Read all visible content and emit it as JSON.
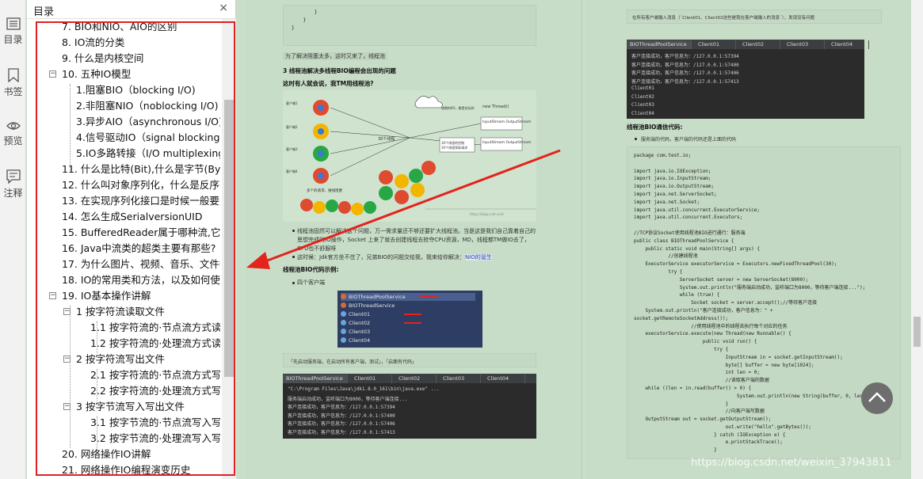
{
  "rail": {
    "items": [
      {
        "label": "目录",
        "icon": "list-icon"
      },
      {
        "label": "书签",
        "icon": "bookmark-icon"
      },
      {
        "label": "预览",
        "icon": "eye-icon"
      },
      {
        "label": "注释",
        "icon": "comment-icon"
      }
    ]
  },
  "outline": {
    "title": "目录",
    "close": "×",
    "items": [
      {
        "text": "7. BIO和NIO、AIO的区别",
        "toggle": ""
      },
      {
        "text": "8. IO流的分类",
        "toggle": ""
      },
      {
        "text": "9. 什么是内核空间",
        "toggle": ""
      },
      {
        "text": "10. 五种IO模型",
        "toggle": "−"
      },
      {
        "text": "1.阻塞BIO（blocking I/O)",
        "toggle": ""
      },
      {
        "text": "2.非阻塞NIO（noblocking I/O)",
        "toggle": ""
      },
      {
        "text": "3.异步AIO（asynchronous I/O)",
        "toggle": ""
      },
      {
        "text": "4.信号驱动IO（signal blocking I/",
        "toggle": ""
      },
      {
        "text": "5.IO多路转接（I/O multiplexing)",
        "toggle": ""
      },
      {
        "text": "11. 什么是比特(Bit),什么是字节(Byte)",
        "toggle": ""
      },
      {
        "text": "12. 什么叫对象序列化，什么是反序列",
        "toggle": ""
      },
      {
        "text": "13. 在实现序列化接口是时候一般要生",
        "toggle": ""
      },
      {
        "text": "14. 怎么生成SerialversionUID",
        "toggle": ""
      },
      {
        "text": "15. BufferedReader属于哪种流,它主",
        "toggle": ""
      },
      {
        "text": "16. Java中流类的超类主要有那些?",
        "toggle": ""
      },
      {
        "text": "17. 为什么图片、视频、音乐、文件等",
        "toggle": ""
      },
      {
        "text": "18. IO的常用类和方法，以及如何使用",
        "toggle": ""
      },
      {
        "text": "19. IO基本操作讲解",
        "toggle": "−"
      },
      {
        "text": "1 按字符流读取文件",
        "toggle": "−"
      },
      {
        "text": "1.1 按字符流的·节点流方式读取",
        "toggle": ""
      },
      {
        "text": "1.2 按字符流的·处理流方式读取",
        "toggle": ""
      },
      {
        "text": "2 按字符流写出文件",
        "toggle": "−"
      },
      {
        "text": "2.1 按字符流的·节点流方式写出",
        "toggle": ""
      },
      {
        "text": "2.2 按字符流的·处理流方式写出",
        "toggle": ""
      },
      {
        "text": "3 按字节流写入写出文件",
        "toggle": "−"
      },
      {
        "text": "3.1 按字节流的·节点流写入写出",
        "toggle": ""
      },
      {
        "text": "3.2 按字节流的·处理流写入写出",
        "toggle": ""
      },
      {
        "text": "20. 网络操作IO讲解",
        "toggle": ""
      },
      {
        "text": "21. 网络操作IO编程演变历史",
        "toggle": ""
      }
    ]
  },
  "doc": {
    "left": {
      "code_top": "        }\n    }\n}",
      "note1": "为了解决阻塞太多，这时又来了，线程池",
      "h3": "3 线程池解决多线程BIO编程会出现的问题",
      "q": "这时有人就会说，我TM用线程池?",
      "diagram": {
        "client_label": "多个客户端",
        "pool_label": "30个线程",
        "server": "new Thread()",
        "stream": "InputStream OutputStream",
        "multi": "多个的请求，维线阻塞",
        "desc1": "该期的IIO，都是实际的",
        "desc2": "30个线程的控制",
        "desc3": "30个线程获取请求",
        "rows": [
          "客户端1",
          "客户端2",
          "客户端3",
          "客户端4"
        ],
        "url": "https://blog.csdn.net/"
      },
      "bullet1": "线程池固然可以解决这个问题，万一需求量还不够还要扩大线程池。当是这是我们自己靠着自己的",
      "bullet1b": "思想完成的IO操作，Socket 上来了就去创建线程去抢夺CPU资源，MD，线程都TM做IO去了，",
      "bullet1c": "CPU也不舒服呀",
      "bullet2_a": "这时候：Jdk官方坐不住了，兄弟BIO的问题交给我，我来给你解决：",
      "bullet2_b": "NIO的诞生",
      "h4": "线程池BIO代码示例:",
      "bullet3": "四个客户端",
      "ide_items": [
        {
          "name": "BIOThreadPoolService",
          "color": "#d46a3a"
        },
        {
          "name": "BIOThreadService",
          "color": "#d46a3a"
        },
        {
          "name": "Client01",
          "color": "#6aa6d8"
        },
        {
          "name": "Client02",
          "color": "#6aa6d8"
        },
        {
          "name": "Client03",
          "color": "#6aa6d8"
        },
        {
          "name": "Client04",
          "color": "#6aa6d8"
        }
      ],
      "note2": "「先启动服务端，在启动所有客户端，测试」，「启面有代码」",
      "term": {
        "tabs": [
          "BIOThreadPoolService",
          "Client01",
          "Client02",
          "Client03",
          "Client04"
        ],
        "lines": [
          "\"C:\\Program Files\\Java\\jdk1.8.0_161\\bin\\java.exe\" ...",
          "服务端启动成功，监听端口为8000，等待客户端连接...",
          "客户连接成功，客户信息为：/127.0.0.1:57394",
          "客户连接成功，客户信息为：/127.0.0.1:57400",
          "客户连接成功，客户信息为：/127.0.0.1:57406",
          "客户连接成功，客户信息为：/127.0.0.1:57413"
        ]
      }
    },
    "right": {
      "note": "在所有客户端输入消息（`Client01、Client02这些是我在客户端输入的消息`），发现没有问题",
      "term": {
        "tabs": [
          "BIOThreadPoolService",
          "Client01",
          "Client02",
          "Client03",
          "Client04"
        ],
        "lines": [
          "客户连接成功，客户信息为：/127.0.0.1:57394",
          "客户连接成功，客户信息为：/127.0.0.1:57400",
          "客户连接成功，客户信息为：/127.0.0.1:57406",
          "客户连接成功，客户信息为：/127.0.0.1:57413",
          "Client01",
          "Client02",
          "Client03",
          "Client04"
        ]
      },
      "h": "线程池BIO通信代码:",
      "bullet": "服务端的代码，客户端的代码还是上面的代码",
      "code": "package com.test.io;\n\nimport java.io.IOException;\nimport java.io.InputStream;\nimport java.io.OutputStream;\nimport java.net.ServerSocket;\nimport java.net.Socket;\nimport java.util.concurrent.ExecutorService;\nimport java.util.concurrent.Executors;\n\n//TCP协议Socket使用线程池BIO进行通行：服务端\npublic class BIOThreadPoolService {\n    public static void main(String[] args) {\n            //创建线程池\n    ExecutorService executorService = Executors.newFixedThreadPool(30);\n            try {\n                ServerSocket server = new ServerSocket(8000);\n                System.out.println(\"服务端启动成功，监听端口为8000，等待客户端连接...\");\n                while (true) {\n                    Socket socket = server.accept();//等待客户连接\n    System.out.println(\"客户连接成功，客户信息为：\" +\nsocket.getRemoteSocketAddress());\n                    //使用线程池中的线程去执行每个对应的任务\n    executorService.execute(new Thread(new Runnable() {\n                        public void run() {\n                            try {\n                                InputStream in = socket.getInputStream();\n                                byte[] buffer = new byte[1024];\n                                int len = 0;\n                                //读取客户端的数据\n    while ((len = in.read(buffer)) > 0) {\n                                    System.out.println(new String(buffer, 0, len));\n                                }\n                                //向客户端写数据\n    OutputStream out = socket.getOutputStream();\n                                out.write(\"hello\".getBytes());\n                            } catch (IOException e) {\n                                e.printStackTrace();\n                            }"
    }
  },
  "watermark": "https://blog.csdn.net/weixin_37943811"
}
